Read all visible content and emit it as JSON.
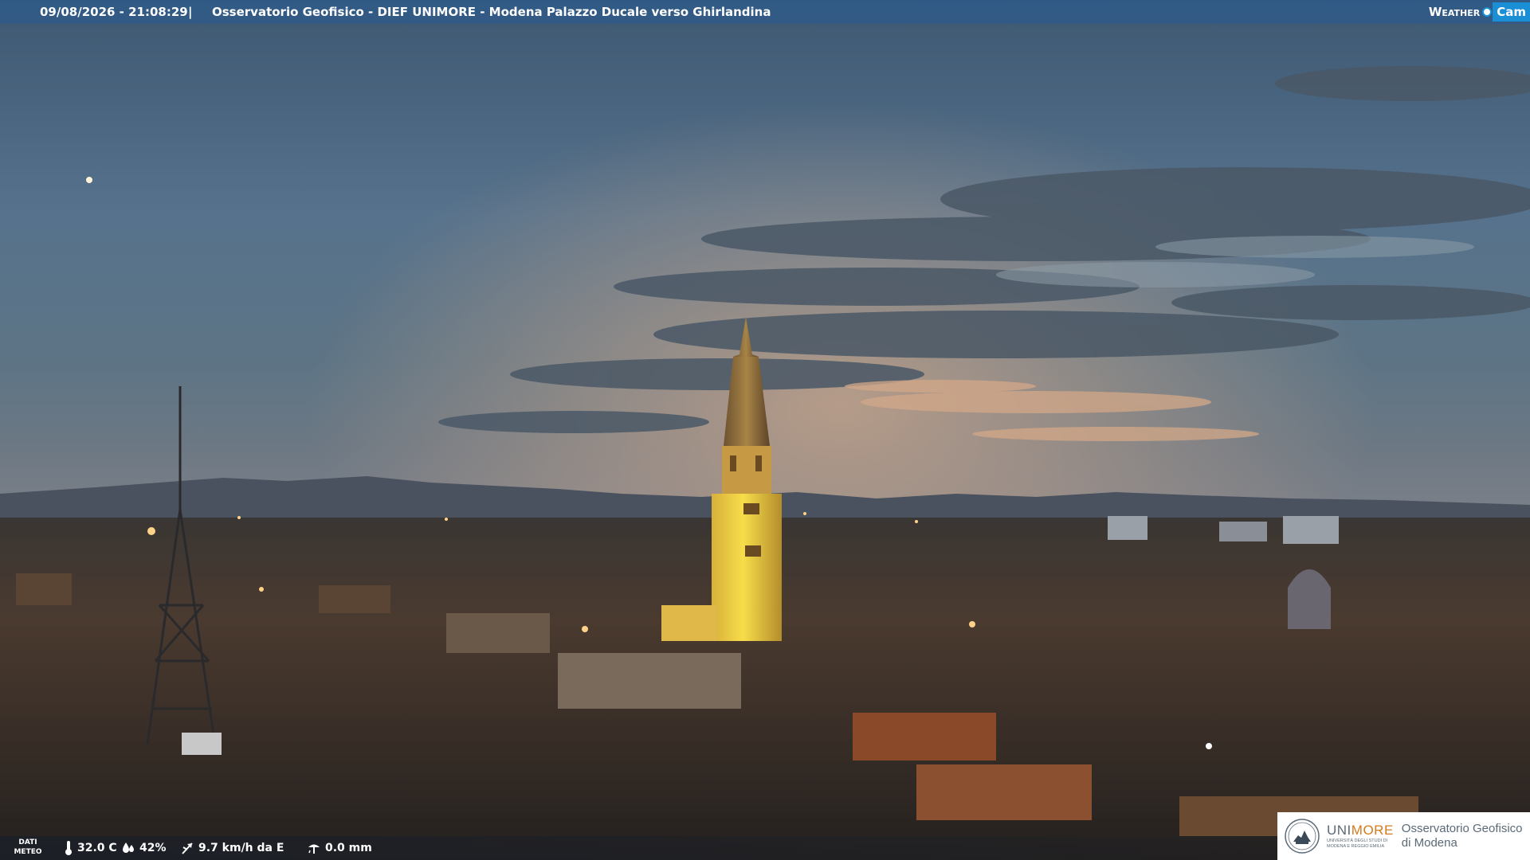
{
  "header": {
    "timestamp": "09/08/2026 - 21:08:29",
    "separator": "|",
    "title": "Osservatorio Geofisico - DIEF UNIMORE - Modena Palazzo Ducale verso Ghirlandina"
  },
  "brand": {
    "weather": "Weather",
    "cam": "Cam"
  },
  "meteo": {
    "label_line1": "DATI",
    "label_line2": "METEO",
    "temperature": "32.0 C",
    "humidity": "42%",
    "wind": "9.7 km/h da E",
    "rain": "0.0 mm"
  },
  "institution": {
    "uni_part1": "UNI",
    "uni_part2": "MORE",
    "uni_sub1": "UNIVERSITÀ DEGLI STUDI DI",
    "uni_sub2": "MODENA E REGGIO EMILIA",
    "observatory_line1": "Osservatorio Geofisico",
    "observatory_line2": "di Modena"
  },
  "colors": {
    "topbar": "#2d5a8c",
    "cam_badge": "#1a8fd6",
    "unimore_orange": "#d67a1e",
    "tower_light": "#f2d23a"
  },
  "icons": {
    "temperature": "thermometer-icon",
    "humidity": "drop-icon",
    "wind": "wind-vane-icon",
    "rain": "rain-gauge-icon",
    "crest": "university-crest-icon"
  }
}
